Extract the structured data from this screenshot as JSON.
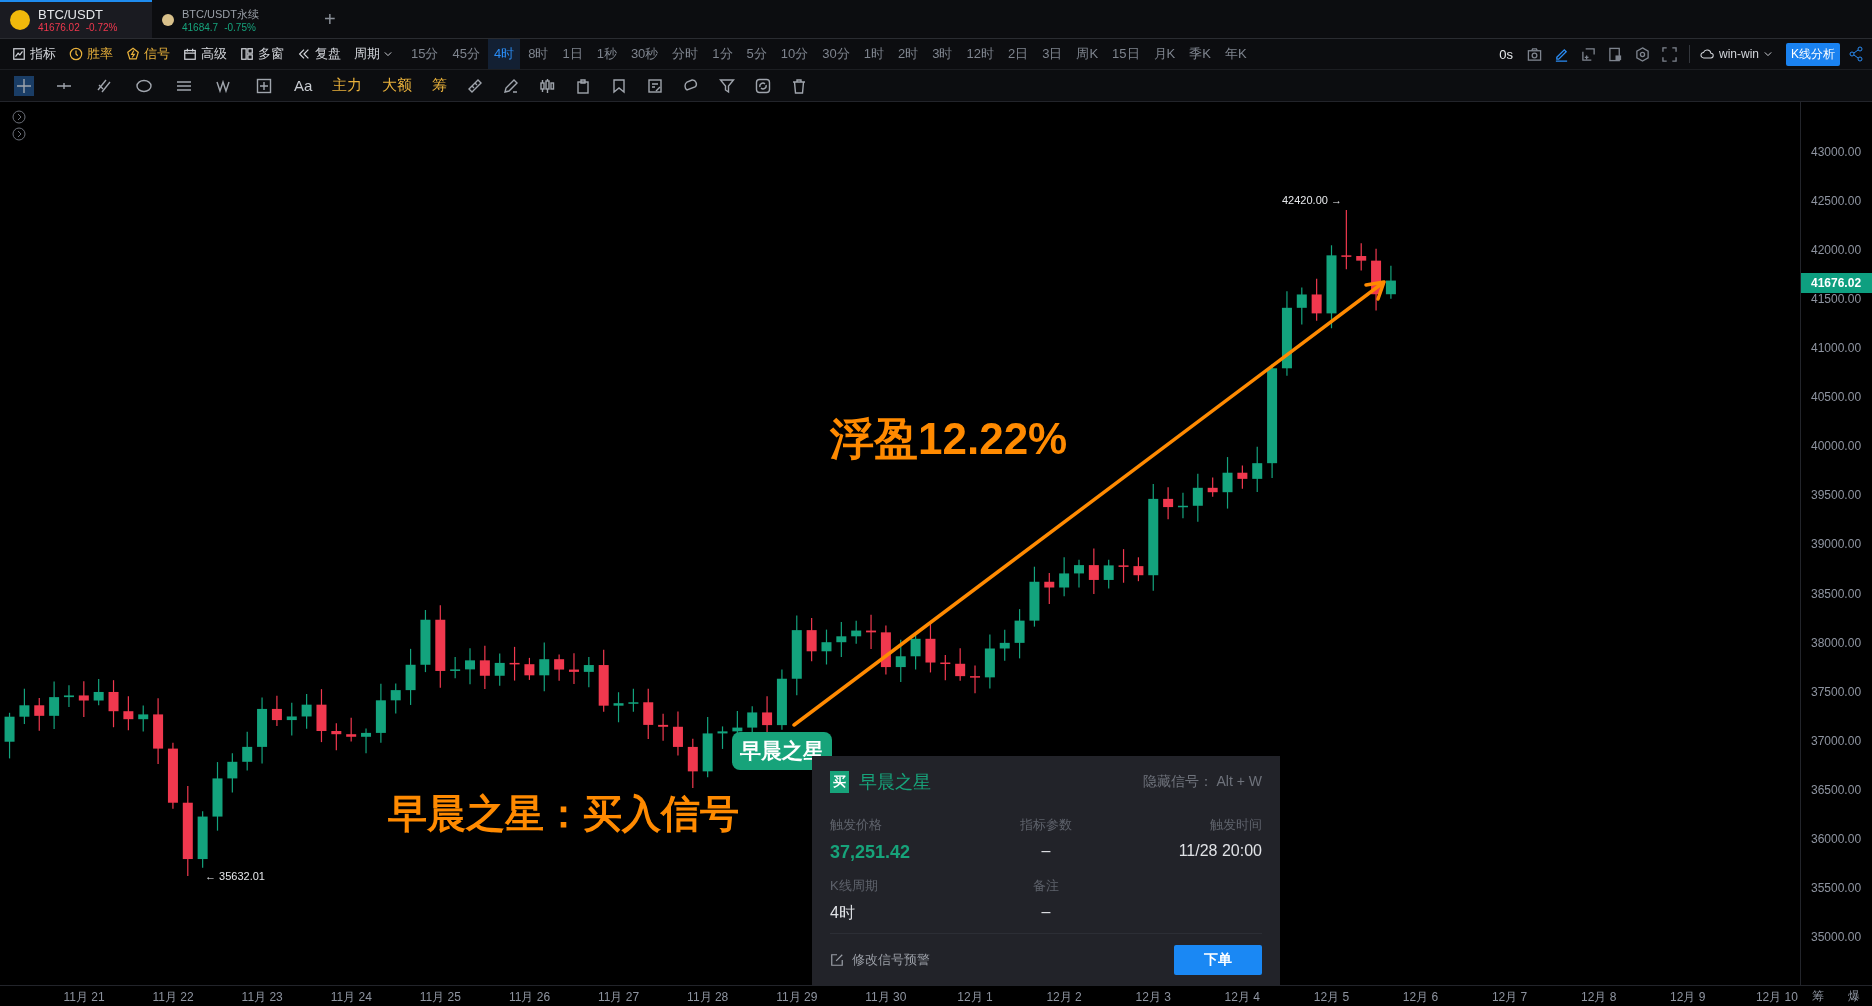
{
  "tabs": [
    {
      "symbol": "BTC/USDT",
      "price": "41676.02",
      "change": "-0.72%",
      "falling": true,
      "selected": true
    },
    {
      "symbol": "BTC/USDT永续",
      "price": "41684.7",
      "change": "-0.75%",
      "falling": false,
      "selected": false
    }
  ],
  "new_tab": "+",
  "toolbar": {
    "tools": [
      {
        "label": "指标",
        "kind": "plain"
      },
      {
        "label": "胜率",
        "kind": "accent"
      },
      {
        "label": "信号",
        "kind": "accent"
      },
      {
        "label": "高级",
        "kind": "plain"
      },
      {
        "label": "多窗",
        "kind": "plain"
      },
      {
        "label": "复盘",
        "kind": "plain"
      },
      {
        "label": "周期",
        "kind": "dropdown"
      }
    ],
    "periods": [
      {
        "label": "15分",
        "selected": false
      },
      {
        "label": "45分",
        "selected": false
      },
      {
        "label": "4时",
        "selected": true
      },
      {
        "label": "8时",
        "selected": false
      },
      {
        "label": "1日",
        "selected": false
      },
      {
        "label": "1秒",
        "selected": false
      },
      {
        "label": "30秒",
        "selected": false
      },
      {
        "label": "分时",
        "selected": false
      },
      {
        "label": "1分",
        "selected": false
      },
      {
        "label": "5分",
        "selected": false
      },
      {
        "label": "10分",
        "selected": false
      },
      {
        "label": "30分",
        "selected": false
      },
      {
        "label": "1时",
        "selected": false
      },
      {
        "label": "2时",
        "selected": false
      },
      {
        "label": "3时",
        "selected": false
      },
      {
        "label": "12时",
        "selected": false
      },
      {
        "label": "2日",
        "selected": false
      },
      {
        "label": "3日",
        "selected": false
      },
      {
        "label": "周K",
        "selected": false
      },
      {
        "label": "15日",
        "selected": false
      },
      {
        "label": "月K",
        "selected": false
      },
      {
        "label": "季K",
        "selected": false
      },
      {
        "label": "年K",
        "selected": false
      }
    ],
    "countdown": "0s",
    "account": "win-win",
    "analysis_button": "K线分析"
  },
  "drawing_toolbar": [
    {
      "label": "Aa",
      "kind": "plain"
    },
    {
      "label": "主力",
      "kind": "accent"
    },
    {
      "label": "大额",
      "kind": "accent"
    },
    {
      "label": "筹",
      "kind": "accent"
    }
  ],
  "chart": {
    "high_label": "42420.00 →",
    "low_label": "← 35632.01",
    "profit_text": "浮盈12.22%",
    "signal_caption": "早晨之星：买入信号",
    "signal_badge": "早晨之星",
    "current_price": "41676.02"
  },
  "price_axis": [
    "43000.00",
    "42500.00",
    "42000.00",
    "41500.00",
    "41000.00",
    "40500.00",
    "40000.00",
    "39500.00",
    "39000.00",
    "38500.00",
    "38000.00",
    "37500.00",
    "37000.00",
    "36500.00",
    "36000.00",
    "35500.00",
    "35000.00"
  ],
  "date_axis": [
    "11月 21",
    "11月 22",
    "11月 23",
    "11月 24",
    "11月 25",
    "11月 26",
    "11月 27",
    "11月 28",
    "11月 29",
    "11月 30",
    "12月 1",
    "12月 2",
    "12月 3",
    "12月 4",
    "12月 5",
    "12月 6",
    "12月 7",
    "12月 8",
    "12月 9",
    "12月 10"
  ],
  "corner_labels": [
    "筹",
    "爆"
  ],
  "signal_popup": {
    "badge": "买",
    "title": "早晨之星",
    "hint": "隐藏信号： Alt + W",
    "fields": [
      {
        "label": "触发价格",
        "value": "37,251.42",
        "kind": "price"
      },
      {
        "label": "指标参数",
        "value": "–",
        "kind": "plain"
      },
      {
        "label": "触发时间",
        "value": "11/28 20:00",
        "kind": "plain"
      },
      {
        "label": "K线周期",
        "value": "4时",
        "kind": "plain"
      },
      {
        "label": "备注",
        "value": "–",
        "kind": "plain"
      }
    ],
    "edit_link": "修改信号预警",
    "order_button": "下单"
  }
}
